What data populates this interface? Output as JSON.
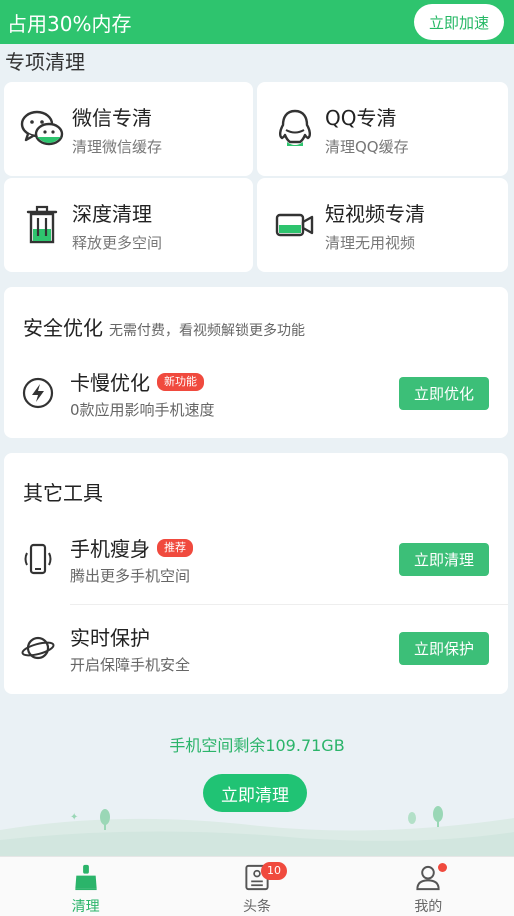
{
  "top_bar": {
    "memory": "占用30%内存",
    "boost_label": "立即加速"
  },
  "special": {
    "title": "专项清理",
    "cards": [
      {
        "title": "微信专清",
        "sub": "清理微信缓存",
        "icon": "wechat-icon"
      },
      {
        "title": "QQ专清",
        "sub": "清理QQ缓存",
        "icon": "qq-icon"
      },
      {
        "title": "深度清理",
        "sub": "释放更多空间",
        "icon": "trash-icon"
      },
      {
        "title": "短视频专清",
        "sub": "清理无用视频",
        "icon": "video-camera-icon"
      }
    ]
  },
  "safety": {
    "title": "安全优化",
    "subtitle": "无需付费，看视频解锁更多功能",
    "items": [
      {
        "title": "卡慢优化",
        "tag": "新功能",
        "sub": "0款应用影响手机速度",
        "button": "立即优化",
        "icon": "lightning-icon"
      }
    ]
  },
  "tools": {
    "title": "其它工具",
    "items": [
      {
        "title": "手机瘦身",
        "tag": "推荐",
        "sub": "腾出更多手机空间",
        "button": "立即清理",
        "icon": "phone-slim-icon"
      },
      {
        "title": "实时保护",
        "tag": "",
        "sub": "开启保障手机安全",
        "button": "立即保护",
        "icon": "planet-icon"
      }
    ]
  },
  "storage": {
    "remaining": "手机空间剩余109.71GB",
    "clean_label": "立即清理"
  },
  "nav": {
    "items": [
      {
        "label": "清理",
        "icon": "broom-icon",
        "active": true
      },
      {
        "label": "头条",
        "icon": "news-icon",
        "badge": "10"
      },
      {
        "label": "我的",
        "icon": "user-icon",
        "dot": true
      }
    ]
  },
  "colors": {
    "accent": "#2ec46e",
    "button": "#3cbf78",
    "tag": "#f04a3e"
  }
}
